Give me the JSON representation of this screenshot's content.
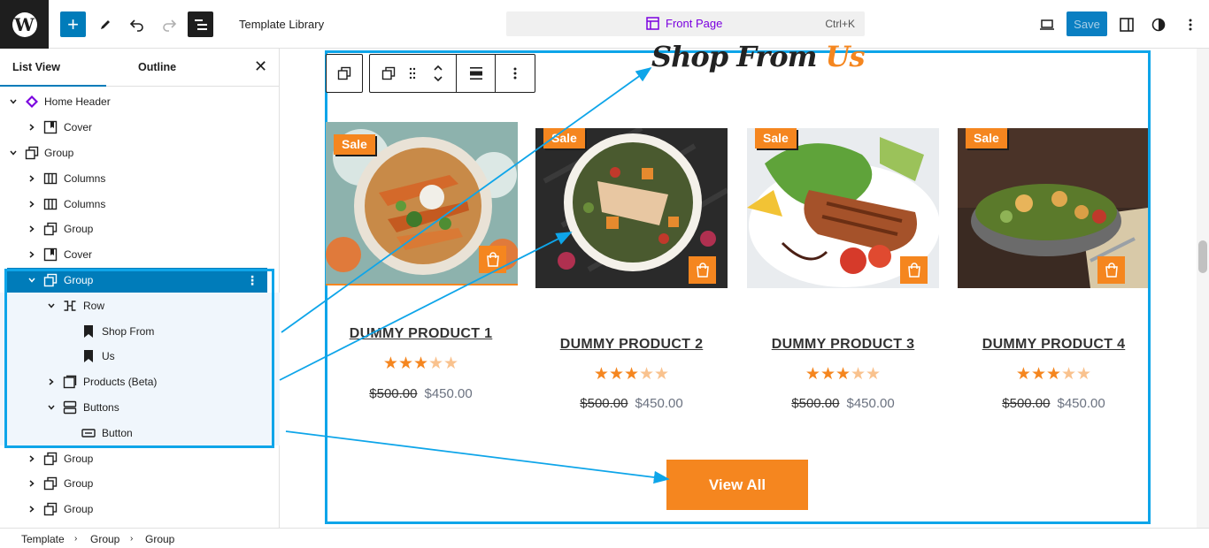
{
  "topbar": {
    "title": "Template Library",
    "command": "Front Page",
    "shortcut": "Ctrl+K",
    "save_label": "Save"
  },
  "panel": {
    "tabs": [
      "List View",
      "Outline"
    ],
    "close_icon": "close-icon",
    "items": [
      {
        "label": "Home Header",
        "icon": "pattern-icon"
      },
      {
        "label": "Cover",
        "icon": "cover-icon"
      },
      {
        "label": "Group",
        "icon": "group-icon"
      },
      {
        "label": "Columns",
        "icon": "columns-icon"
      },
      {
        "label": "Columns",
        "icon": "columns-icon"
      },
      {
        "label": "Group",
        "icon": "group-icon"
      },
      {
        "label": "Cover",
        "icon": "cover-icon"
      },
      {
        "label": "Group",
        "icon": "group-icon"
      },
      {
        "label": "Row",
        "icon": "row-icon"
      },
      {
        "label": "Shop From",
        "icon": "bookmark-icon"
      },
      {
        "label": "Us",
        "icon": "bookmark-icon"
      },
      {
        "label": "Products (Beta)",
        "icon": "products-icon"
      },
      {
        "label": "Buttons",
        "icon": "buttons-icon"
      },
      {
        "label": "Button",
        "icon": "button-icon"
      },
      {
        "label": "Group",
        "icon": "group-icon"
      },
      {
        "label": "Group",
        "icon": "group-icon"
      },
      {
        "label": "Group",
        "icon": "group-icon"
      }
    ]
  },
  "breadcrumb": [
    "Template",
    "Group",
    "Group"
  ],
  "canvas": {
    "heading_part1": "Shop From",
    "heading_part2": "Us",
    "sale_label": "Sale",
    "rating": 3,
    "rating_max": 5,
    "products": [
      {
        "name": "DUMMY PRODUCT 1",
        "old_price": "$500.00",
        "price": "$450.00"
      },
      {
        "name": "DUMMY PRODUCT 2",
        "old_price": "$500.00",
        "price": "$450.00"
      },
      {
        "name": "DUMMY PRODUCT 3",
        "old_price": "$500.00",
        "price": "$450.00"
      },
      {
        "name": "DUMMY PRODUCT 4",
        "old_price": "$500.00",
        "price": "$450.00"
      }
    ],
    "view_all_label": "View All"
  },
  "colors": {
    "accent": "#007cba",
    "highlight": "#0ea5e9",
    "brand_orange": "#f5861f",
    "command_purple": "#7a00df"
  }
}
